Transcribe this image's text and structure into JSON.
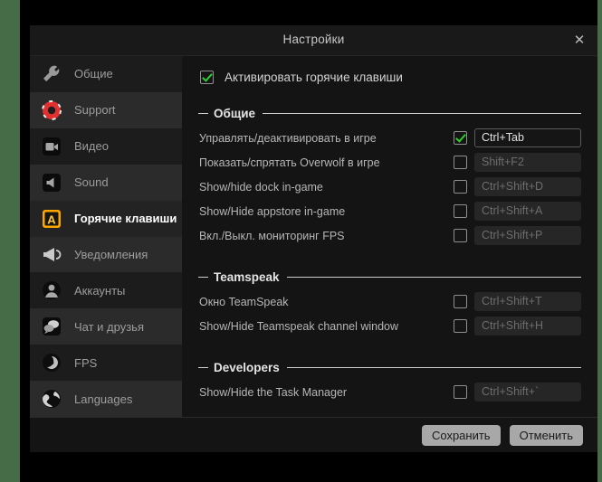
{
  "window": {
    "title": "Настройки",
    "close_icon": "close-x-icon"
  },
  "sidebar": {
    "items": [
      {
        "label": "Общие",
        "icon": "wrench-icon",
        "active": false
      },
      {
        "label": "Support",
        "icon": "lifebuoy-icon",
        "active": false
      },
      {
        "label": "Видео",
        "icon": "video-camera-icon",
        "active": false
      },
      {
        "label": "Sound",
        "icon": "speaker-icon",
        "active": false
      },
      {
        "label": "Горячие клавиши",
        "icon": "letter-a-icon",
        "active": true
      },
      {
        "label": "Уведомления",
        "icon": "megaphone-icon",
        "active": false
      },
      {
        "label": "Аккаунты",
        "icon": "user-icon",
        "active": false
      },
      {
        "label": "Чат и друзья",
        "icon": "chat-bubbles-icon",
        "active": false
      },
      {
        "label": "FPS",
        "icon": "gauge-icon",
        "active": false
      },
      {
        "label": "Languages",
        "icon": "globe-icon",
        "active": false
      }
    ]
  },
  "content": {
    "master_toggle": {
      "label": "Активировать горячие клавиши",
      "checked": true
    },
    "sections": [
      {
        "title": "Общие",
        "rows": [
          {
            "label": "Управлять/деактивировать в игре",
            "hotkey": "Ctrl+Tab",
            "checked": true,
            "enabled": true
          },
          {
            "label": "Показать/спрятать Overwolf в игре",
            "hotkey": "Shift+F2",
            "checked": false,
            "enabled": false
          },
          {
            "label": "Show/hide dock in-game",
            "hotkey": "Ctrl+Shift+D",
            "checked": false,
            "enabled": false
          },
          {
            "label": "Show/Hide appstore in-game",
            "hotkey": "Ctrl+Shift+A",
            "checked": false,
            "enabled": false
          },
          {
            "label": "Вкл./Выкл. мониторинг FPS",
            "hotkey": "Ctrl+Shift+P",
            "checked": false,
            "enabled": false
          }
        ]
      },
      {
        "title": "Teamspeak",
        "rows": [
          {
            "label": "Окно TeamSpeak",
            "hotkey": "Ctrl+Shift+T",
            "checked": false,
            "enabled": false
          },
          {
            "label": "Show/Hide Teamspeak channel window",
            "hotkey": "Ctrl+Shift+H",
            "checked": false,
            "enabled": false
          }
        ]
      },
      {
        "title": "Developers",
        "rows": [
          {
            "label": "Show/Hide the Task Manager",
            "hotkey": "Ctrl+Shift+`",
            "checked": false,
            "enabled": false
          }
        ]
      }
    ]
  },
  "footer": {
    "save_label": "Сохранить",
    "cancel_label": "Отменить"
  },
  "colors": {
    "accent_green": "#2fd02f",
    "hotkey_icon_orange": "#ffa500",
    "support_red": "#e03030",
    "desktop_green": "#466b47"
  }
}
